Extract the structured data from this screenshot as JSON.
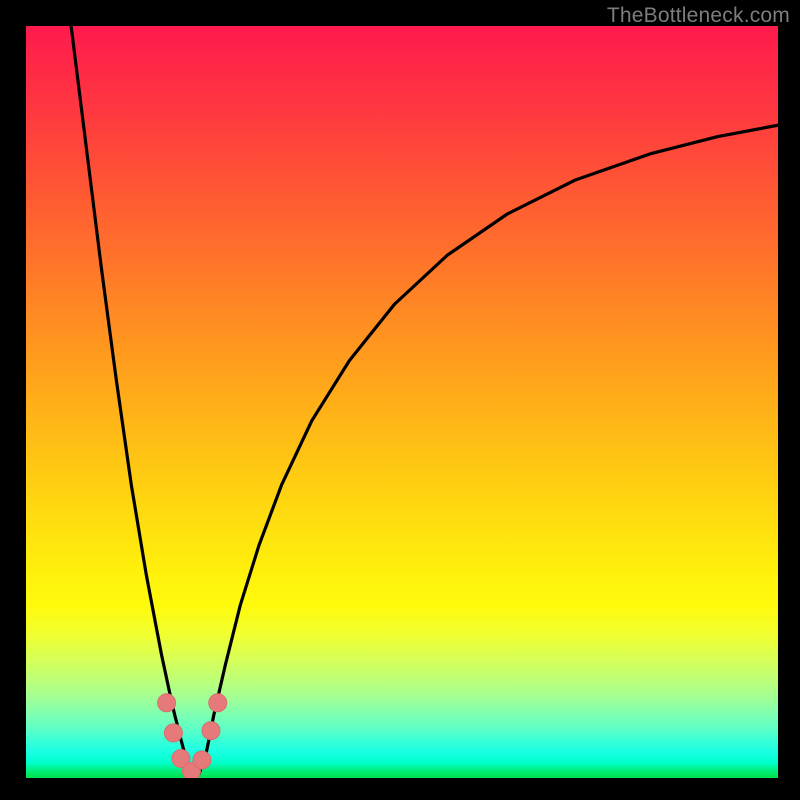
{
  "watermark": "TheBottleneck.com",
  "colors": {
    "curve_stroke": "#000000",
    "marker_fill": "#e67a7a",
    "marker_stroke": "#d96d6d"
  },
  "chart_data": {
    "type": "line",
    "title": "",
    "xlabel": "",
    "ylabel": "",
    "xlim": [
      0,
      100
    ],
    "ylim": [
      0,
      100
    ],
    "grid": false,
    "legend": false,
    "series": [
      {
        "name": "left-branch",
        "x": [
          6.0,
          8.0,
          10.0,
          12.0,
          14.0,
          16.0,
          18.0,
          19.5,
          20.5,
          21.3,
          22.0
        ],
        "y": [
          100.0,
          84.0,
          68.0,
          53.0,
          39.0,
          27.0,
          16.5,
          9.5,
          5.5,
          2.5,
          0.5
        ]
      },
      {
        "name": "right-branch",
        "x": [
          23.0,
          24.0,
          25.0,
          26.5,
          28.5,
          31.0,
          34.0,
          38.0,
          43.0,
          49.0,
          56.0,
          64.0,
          73.0,
          83.0,
          92.0,
          100.0
        ],
        "y": [
          0.5,
          3.5,
          8.5,
          15.0,
          23.0,
          31.0,
          39.0,
          47.5,
          55.5,
          63.0,
          69.5,
          75.0,
          79.5,
          83.0,
          85.3,
          86.8
        ]
      }
    ],
    "markers": [
      {
        "x": 18.7,
        "y": 10.0
      },
      {
        "x": 19.6,
        "y": 6.0
      },
      {
        "x": 20.6,
        "y": 2.6
      },
      {
        "x": 22.0,
        "y": 0.9
      },
      {
        "x": 23.4,
        "y": 2.4
      },
      {
        "x": 24.6,
        "y": 6.3
      },
      {
        "x": 25.5,
        "y": 10.0
      }
    ],
    "annotations": []
  }
}
